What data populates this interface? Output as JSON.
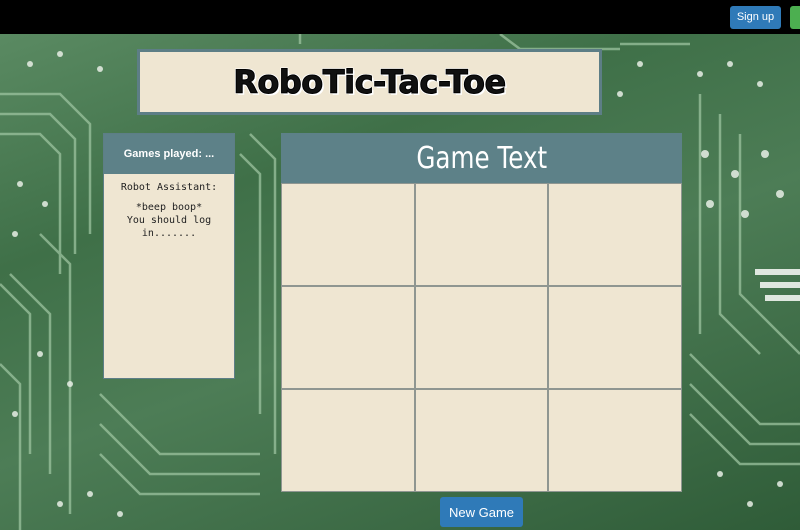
{
  "nav": {
    "signup_label": "Sign up"
  },
  "title": "RoboTic-Tac-Toe",
  "side_panel": {
    "games_played": "Games played: ...",
    "assistant_label": "Robot Assistant:",
    "assistant_message": "*beep boop*\nYou should log\nin......."
  },
  "game": {
    "header": "Game Text",
    "cells": [
      "",
      "",
      "",
      "",
      "",
      "",
      "",
      "",
      ""
    ],
    "new_game_label": "New Game"
  },
  "colors": {
    "accent_teal": "#5d8188",
    "panel_bg": "#efe6d2",
    "button_blue": "#2f7ab8",
    "nav_green": "#4caf50",
    "board_green": "#4d7d56"
  }
}
